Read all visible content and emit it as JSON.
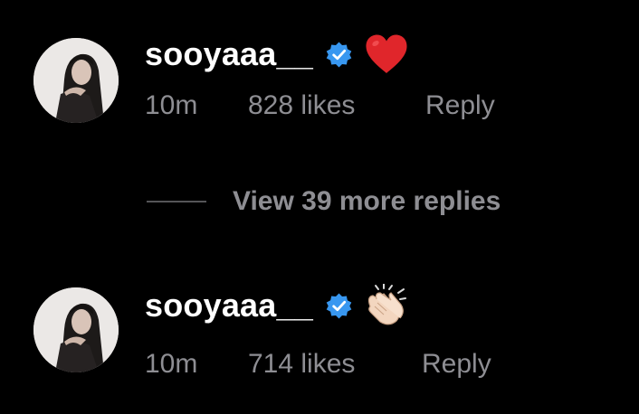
{
  "comments": [
    {
      "username": "sooyaaa__",
      "emoji": "heart",
      "time": "10m",
      "likes": "828 likes",
      "reply": "Reply"
    },
    {
      "username": "sooyaaa__",
      "emoji": "clapping-hands",
      "time": "10m",
      "likes": "714 likes",
      "reply": "Reply"
    }
  ],
  "view_more_replies": "View 39 more replies",
  "colors": {
    "background": "#000000",
    "text_primary": "#ffffff",
    "text_secondary": "#8e8e93",
    "verified_badge": "#3897f0",
    "heart": "#e0262b"
  }
}
